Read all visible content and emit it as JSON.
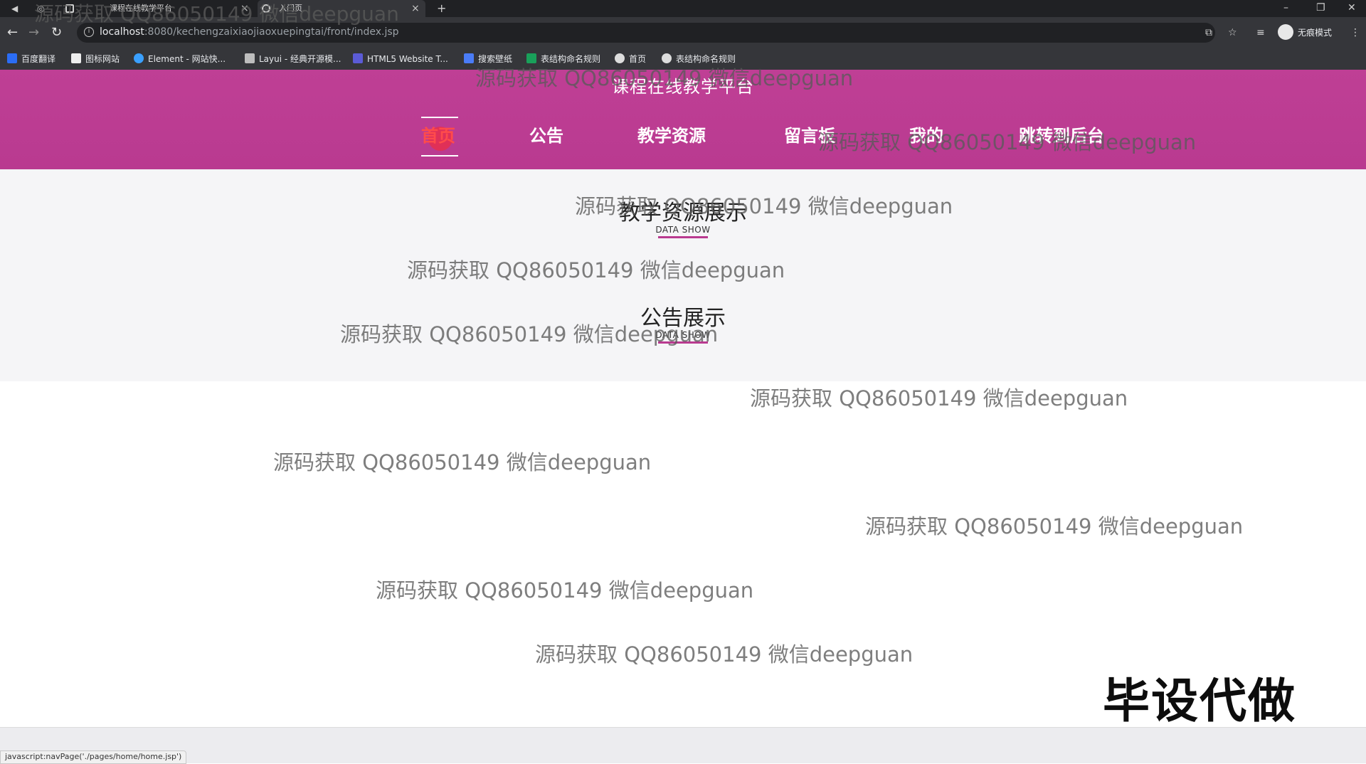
{
  "browser": {
    "tabs": [
      {
        "label": "课程在线教学平台"
      },
      {
        "label": "入门页"
      }
    ],
    "address": {
      "host": "localhost",
      "path": ":8080/kechengzaixiaojiaoxuepingtai/front/index.jsp"
    },
    "profile_label": "无痕模式",
    "bookmarks": [
      {
        "label": "百度翻译",
        "color": "#2b6df5"
      },
      {
        "label": "图标网站",
        "color": "#ffffff"
      },
      {
        "label": "Element - 网站快...",
        "color": "#3aa0ff"
      },
      {
        "label": "Layui - 经典开源模...",
        "color": "#cccccc"
      },
      {
        "label": "HTML5 Website T...",
        "color": "#5b5bd6"
      },
      {
        "label": "搜索壁纸",
        "color": "#4a7cf7"
      },
      {
        "label": "表结构命名规则",
        "color": "#19a05a"
      },
      {
        "label": "首页",
        "color": "#ffffff"
      },
      {
        "label": "表结构命名规则",
        "color": "#ffffff"
      }
    ]
  },
  "site": {
    "title": "课程在线教学平台",
    "nav": [
      {
        "label": "首页",
        "active": true
      },
      {
        "label": "公告"
      },
      {
        "label": "教学资源"
      },
      {
        "label": "留言板"
      },
      {
        "label": "我的"
      },
      {
        "label": "跳转到后台"
      }
    ],
    "sections": [
      {
        "title": "教学资源展示",
        "subtitle": "DATA SHOW"
      },
      {
        "title": "公告展示",
        "subtitle": "DATA SHOW"
      }
    ],
    "accent_color": "#b93a90"
  },
  "status_bar": {
    "link": "javascript:navPage('./pages/home/home.jsp')"
  },
  "overlays": {
    "watermarks": [
      "源码获取 QQ86050149 微信deepguan",
      "源码获取 QQ86050149 微信deepguan",
      "源码获取 QQ86050149 微信deepguan",
      "源码获取 QQ86050149 微信deepguan",
      "源码获取 QQ86050149 微信deepguan",
      "源码获取 QQ86050149 微信deepguan",
      "源码获取 QQ86050149 微信deepguan",
      "源码获取 QQ86050149 微信deepguan",
      "源码获取 QQ86050149 微信deepguan",
      "源码获取 QQ86050149 微信deepguan",
      "源码获取 QQ86050149 微信deepguan"
    ],
    "stamp": "毕设代做"
  }
}
